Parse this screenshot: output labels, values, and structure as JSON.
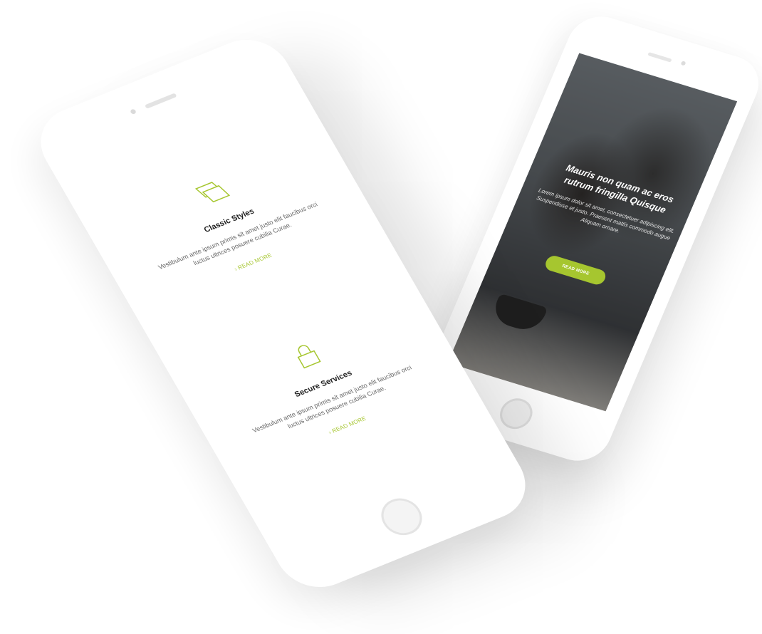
{
  "hero": {
    "title": "Mauris non quam ac eros rutrum fringilla Quisque",
    "text": "Lorem ipsum dolor sit amet, consectetuer adipiscing elit. Suspendisse et justo. Praesent mattis commodo augue Aliquam ornare.",
    "button_label": "READ MORE"
  },
  "features": [
    {
      "icon": "layers-icon",
      "title": "Classic Styles",
      "text": "Vestibulum ante ipsum primis sit amet justo elit faucibus orci luctus ultrices posuere cubilia Curae.",
      "link": "READ MORE"
    },
    {
      "icon": "lock-icon",
      "title": "Secure Services",
      "text": "Vestibulum ante ipsum primis sit amet justo elit faucibus orci luctus ultrices posuere cubilia Curae.",
      "link": "READ MORE"
    }
  ],
  "colors": {
    "accent": "#a6c62f",
    "phone_body": "#ffffff",
    "heading": "#1f1f1f",
    "body_text": "#666666"
  }
}
